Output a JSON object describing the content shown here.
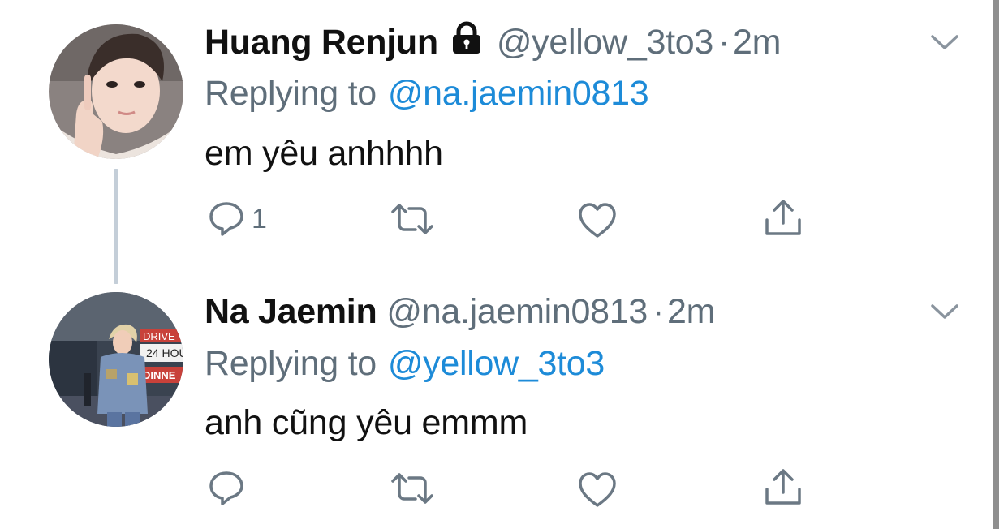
{
  "tweets": [
    {
      "display_name": "Huang Renjun",
      "protected": true,
      "handle": "@yellow_3to3",
      "separator": "·",
      "time": "2m",
      "replying_prefix": "Replying to",
      "replying_to": "@na.jaemin0813",
      "text": "em yêu anhhhh",
      "reply_count": "1",
      "icons": [
        "reply-icon",
        "retweet-icon",
        "like-icon",
        "share-icon",
        "chevron-down-icon",
        "lock-icon"
      ]
    },
    {
      "display_name": "Na Jaemin",
      "protected": false,
      "handle": "@na.jaemin0813",
      "separator": "·",
      "time": "2m",
      "replying_prefix": "Replying to",
      "replying_to": "@yellow_3to3",
      "text": "anh cũng yêu emmm",
      "reply_count": "",
      "avatar_signs": [
        "DRIVE T",
        "24 HOU",
        "DINNE"
      ],
      "icons": [
        "reply-icon",
        "retweet-icon",
        "like-icon",
        "share-icon",
        "chevron-down-icon"
      ]
    }
  ],
  "colors": {
    "name": "#111111",
    "secondary": "#5f6e7a",
    "link": "#1d8bd8",
    "thread_line": "#c4ced8",
    "icon": "#6b7884"
  }
}
